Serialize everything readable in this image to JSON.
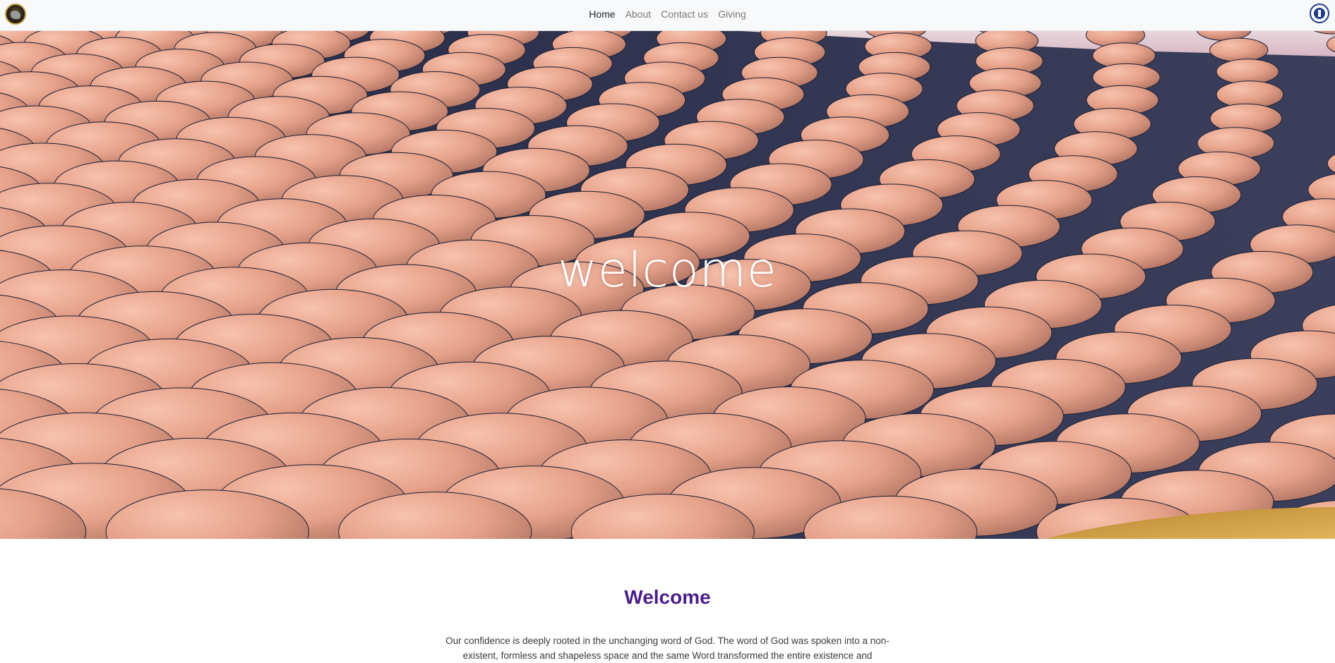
{
  "nav": {
    "links": [
      {
        "label": "Home",
        "active": true
      },
      {
        "label": "About",
        "active": false
      },
      {
        "label": "Contact us",
        "active": false
      },
      {
        "label": "Giving",
        "active": false
      }
    ]
  },
  "hero": {
    "title": "welcome"
  },
  "main": {
    "title": "Welcome",
    "intro": "Our confidence is deeply rooted in the unchanging word of God. The word of God was spoken into a non-existent, formless and shapeless space and the same Word transformed the entire existence and"
  },
  "colors": {
    "accent": "#4b1e87",
    "nav_bg": "#f8f9fa",
    "disc": "#e8a48f",
    "hero_bg": "#2a2f4a"
  },
  "icons": {
    "left_logo": "church-emblem-icon",
    "right_logo": "rccg-logo-icon"
  }
}
